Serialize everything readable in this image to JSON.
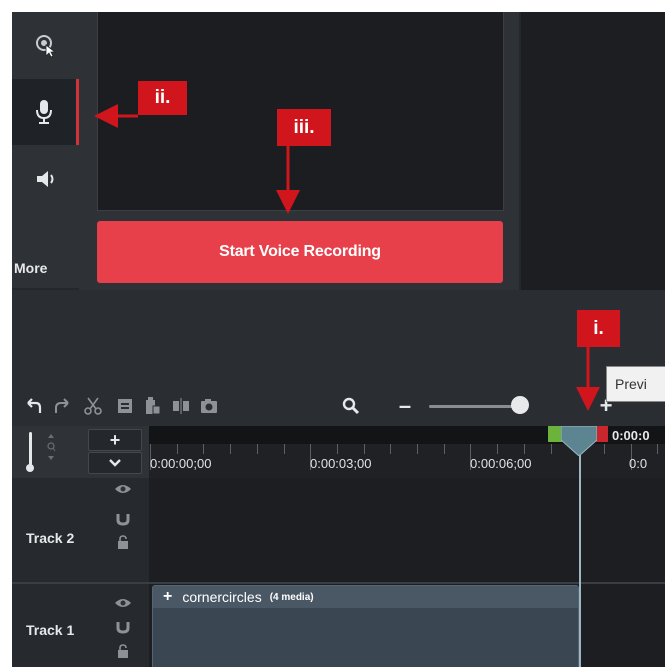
{
  "sidebar": {
    "items": [
      {
        "icon": "cursor-effects-icon"
      },
      {
        "icon": "microphone-icon",
        "active": true
      },
      {
        "icon": "speaker-icon"
      }
    ],
    "more_label": "More"
  },
  "voice_recording": {
    "button_label": "Start Voice Recording"
  },
  "callouts": {
    "i": "i.",
    "ii": "ii.",
    "iii": "iii."
  },
  "toolbar": {
    "tooltip_text": "Previ",
    "icons": [
      "undo-icon",
      "redo-icon",
      "cut-icon",
      "copy-icon",
      "paste-icon",
      "split-icon",
      "snapshot-icon",
      "zoom-search-icon",
      "zoom-out-icon",
      "zoom-in-icon"
    ],
    "zoom_out": "–",
    "zoom_in": "+"
  },
  "timeline": {
    "add_track": "+",
    "collapse": "⌄",
    "playhead_time": "0:00:0",
    "ruler_times": [
      "0:00:00;00",
      "0:00:03;00",
      "0:00:06;00",
      "0:0"
    ],
    "tracks": [
      {
        "name": "Track 2"
      },
      {
        "name": "Track 1"
      }
    ],
    "clip": {
      "plus": "+",
      "name": "cornercircles",
      "meta": "(4 media)"
    }
  },
  "colors": {
    "accent_red": "#e8404a",
    "callout_red": "#d0151d",
    "background": "#24272b"
  }
}
